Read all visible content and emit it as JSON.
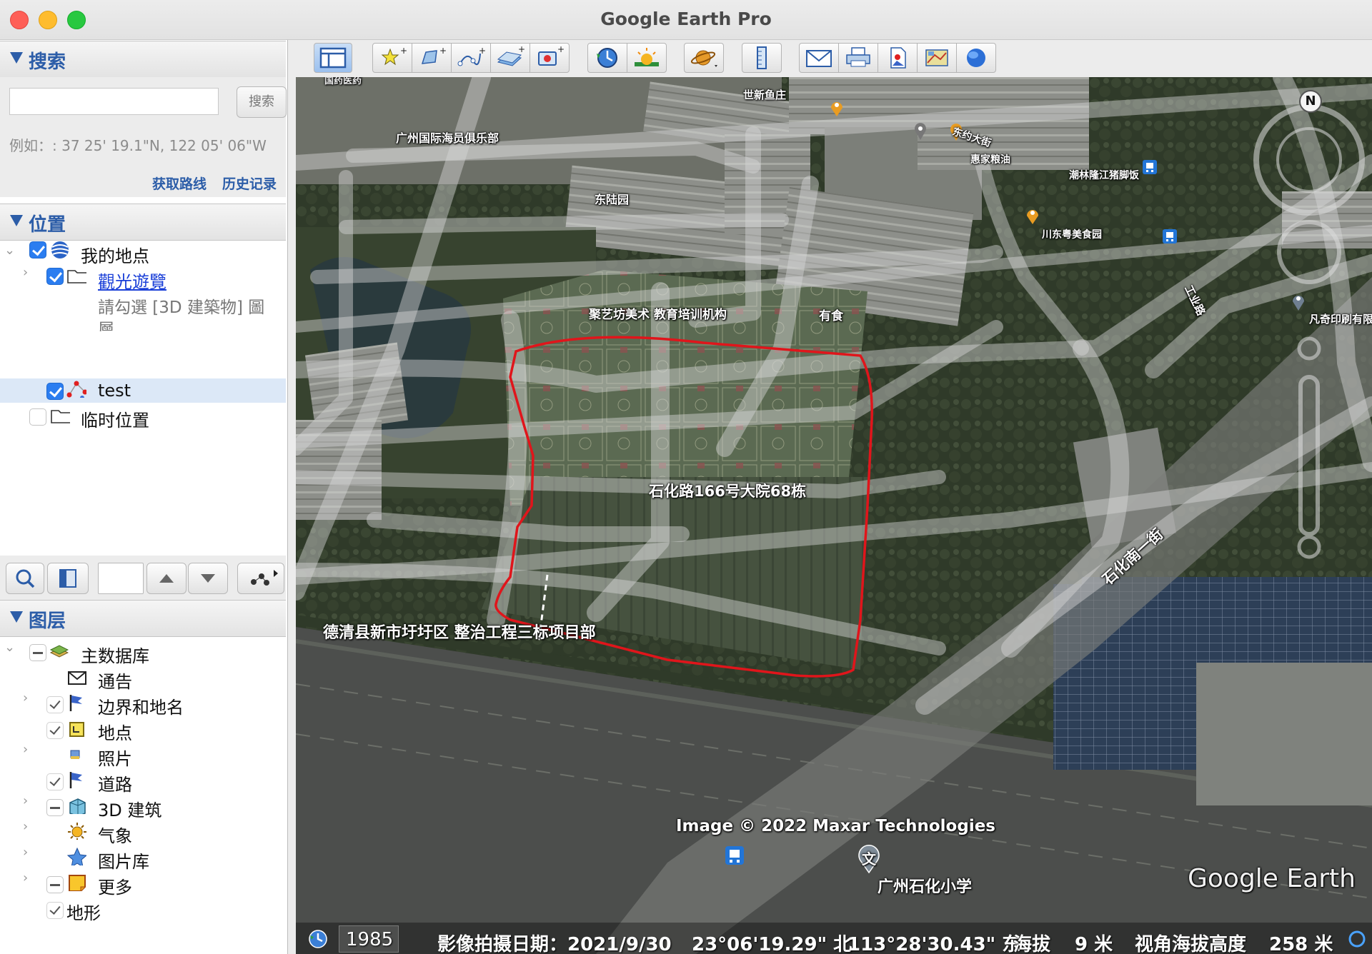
{
  "window": {
    "title": "Google Earth Pro"
  },
  "search": {
    "header": "搜索",
    "placeholder": "",
    "button": "搜索",
    "example": "例如：: 37 25' 19.1\"N, 122 05' 06\"W",
    "get_directions": "获取路线",
    "history": "历史记录"
  },
  "places": {
    "header": "位置",
    "my_places": "我的地点",
    "tour": "觀光遊覽",
    "tour_hint_1": "請勾選 [3D 建築物] 圖",
    "tour_hint_2": "層",
    "test": "test",
    "temp": "临时位置"
  },
  "layers": {
    "header": "图层",
    "items": [
      {
        "label": "主数据库",
        "state": "partial"
      },
      {
        "label": "通告",
        "state": "off"
      },
      {
        "label": "边界和地名",
        "state": "on"
      },
      {
        "label": "地点",
        "state": "on"
      },
      {
        "label": "照片",
        "state": "off"
      },
      {
        "label": "道路",
        "state": "on"
      },
      {
        "label": "3D 建筑",
        "state": "partial"
      },
      {
        "label": "气象",
        "state": "off"
      },
      {
        "label": "图片库",
        "state": "off"
      },
      {
        "label": "更多",
        "state": "partial"
      },
      {
        "label": "地形",
        "state": "on"
      }
    ]
  },
  "map": {
    "labels": {
      "shixin": "世新鱼庄",
      "gz_club": "广州国际海员俱乐部",
      "dongyue": "东约大街",
      "huijia": "惠家粮油",
      "chaolin": "潮林隆江猪脚饭",
      "donglu": "东陆园",
      "chuandong": "川东粤美食园",
      "juyi": "聚艺坊美术 教育培训机构",
      "youshi": "有食",
      "gongye": "工业路",
      "fanqi": "凡奇印刷有限",
      "shihua": "石化路166号大院68栋",
      "shihua_nan": "石化南一街",
      "deqing": "德清县新市圩圩区 整治工程三标项目部",
      "copyright": "Image © 2022 Maxar Technologies",
      "school": "广州石化小学",
      "school_icon": "文",
      "brand": "Google Earth",
      "top_cut": "国药医药"
    },
    "compass_n": "N"
  },
  "status": {
    "year": "1985",
    "imagery_date": "影像拍摄日期：2021/9/30",
    "lat": "23°06'19.29\" 北",
    "lon": "113°28'30.43\" 东",
    "elev_label": "海拔",
    "elev_value": "9 米",
    "eye_label": "视角海拔高度",
    "eye_value": "258 米"
  },
  "colors": {
    "accent": "#2c5da8",
    "polygon": "#e0151b",
    "checkbox": "#2b7df0"
  }
}
